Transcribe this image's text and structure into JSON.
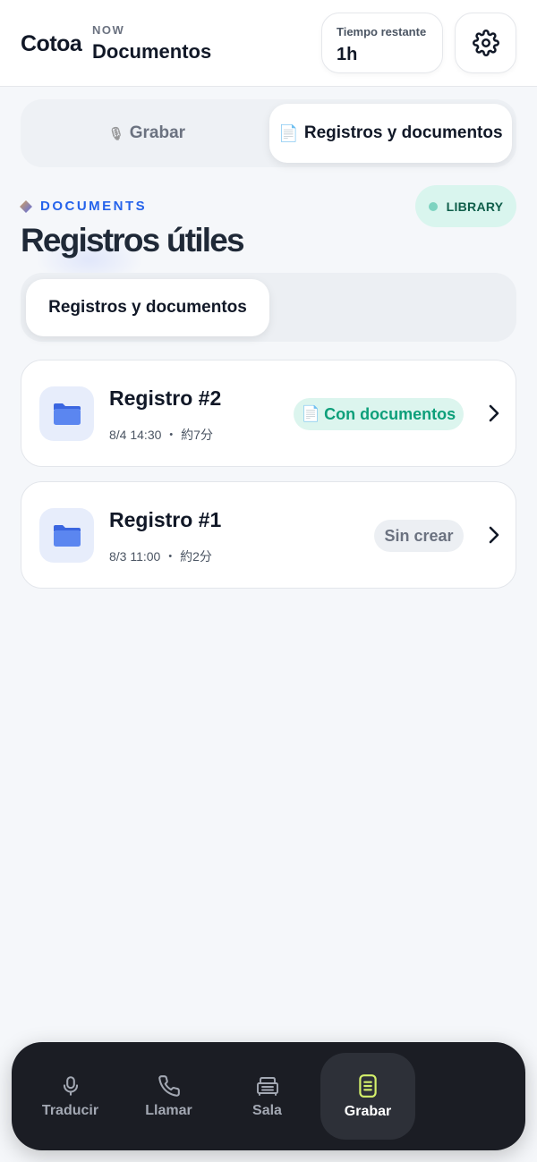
{
  "header": {
    "brand": "Cotoa",
    "now_label": "NOW",
    "title": "Documentos",
    "time": {
      "label": "Tiempo restante",
      "value": "1h"
    },
    "settings_icon": "gear-icon"
  },
  "mode_tabs": [
    {
      "icon": "🎙",
      "label": "Grabar",
      "active": false
    },
    {
      "icon": "📄",
      "label": "Registros y documentos",
      "active": true
    }
  ],
  "section": {
    "eyebrow": "DOCUMENTS",
    "badge": "LIBRARY",
    "title": "Registros útiles",
    "tabs": [
      {
        "label": "Registros y documentos",
        "active": true
      }
    ]
  },
  "records": [
    {
      "name": "Registro #2",
      "meta": "8/4 14:30 ・ 約7分",
      "status": "Con documentos",
      "status_icon": "📄",
      "status_type": "ready",
      "icon": "folder-icon"
    },
    {
      "name": "Registro #1",
      "meta": "8/3 11:00 ・ 約2分",
      "status": "Sin crear",
      "status_type": "none",
      "icon": "folder-icon"
    }
  ],
  "colors": {
    "accent": "#2563eb",
    "success": "#0d9f7a",
    "nav_bg": "#1b1d24",
    "nav_active_icon": "#d4f06b"
  },
  "bottom_nav": [
    {
      "label": "Traducir",
      "icon": "microphone-icon",
      "active": false
    },
    {
      "label": "Llamar",
      "icon": "phone-icon",
      "active": false
    },
    {
      "label": "Sala",
      "icon": "room-icon",
      "active": false
    },
    {
      "label": "Grabar",
      "icon": "document-icon",
      "active": true
    }
  ]
}
